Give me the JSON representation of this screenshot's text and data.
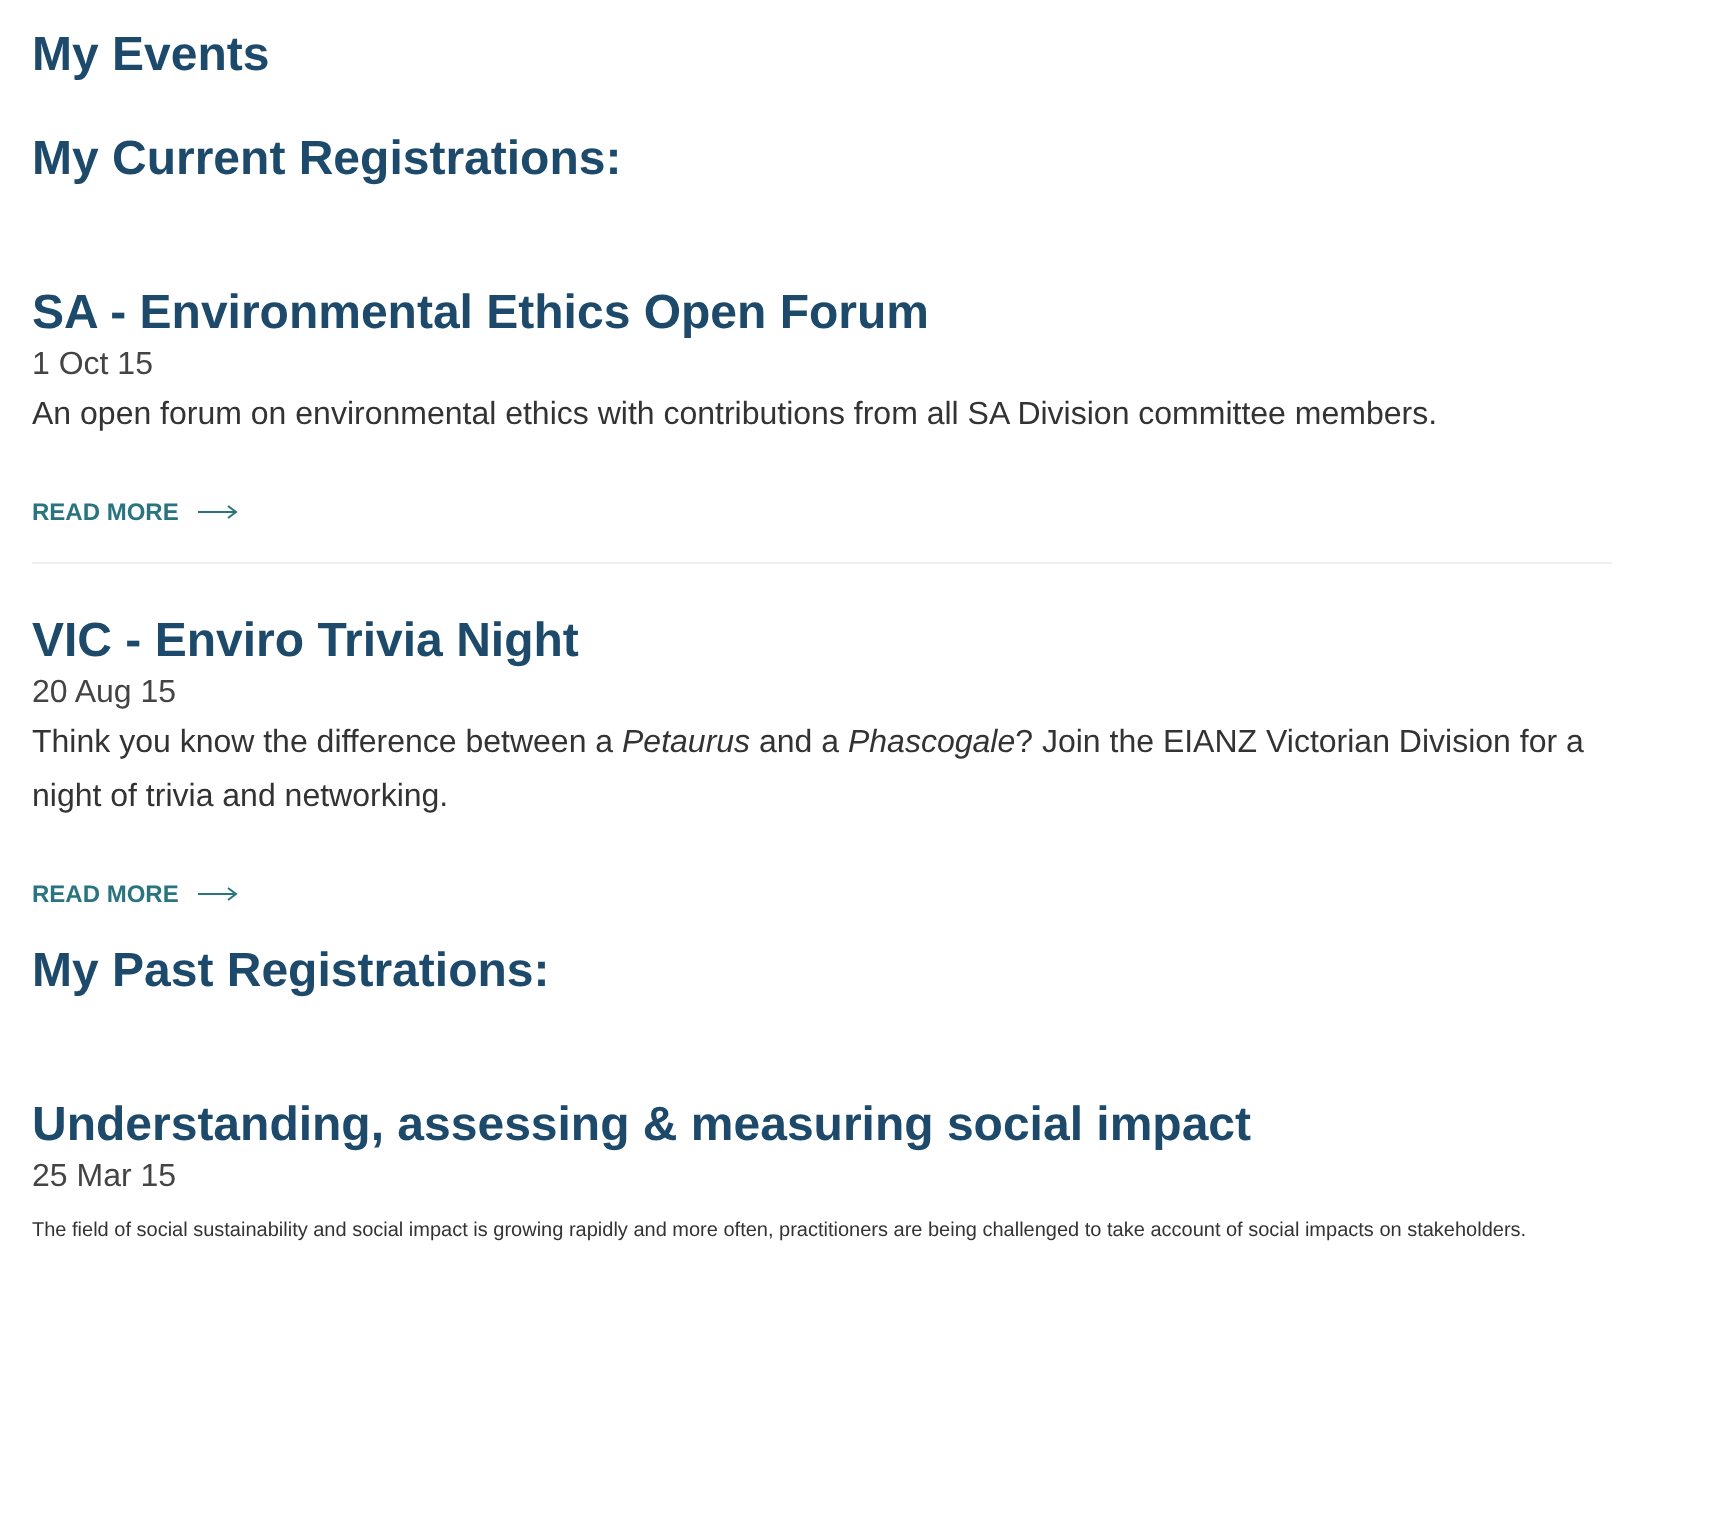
{
  "title": "My Events",
  "sections": [
    {
      "heading": "My Current Registrations:",
      "events": [
        {
          "title": "SA - Environmental Ethics Open Forum",
          "date": "1 Oct 15",
          "description": "An open forum on environmental ethics with contributions from all SA Division committee members.",
          "kind": "current",
          "read_more": "READ MORE",
          "divider": true
        },
        {
          "title": "VIC - Enviro Trivia Night",
          "date": "20 Aug 15",
          "description": "Think you know the difference between a *Petaurus* and a *Phascogale*? Join the EIANZ Victorian Division for a night of trivia and networking.",
          "kind": "current",
          "read_more": "READ MORE",
          "divider": false
        }
      ]
    },
    {
      "heading": "My Past Registrations:",
      "events": [
        {
          "title": "Understanding, assessing & measuring social impact",
          "date": "25 Mar 15",
          "description": "The field of social sustainability and social impact is growing rapidly and more often, practitioners are being challenged to take account of social impacts on stakeholders.",
          "kind": "past",
          "divider": false
        }
      ]
    }
  ]
}
